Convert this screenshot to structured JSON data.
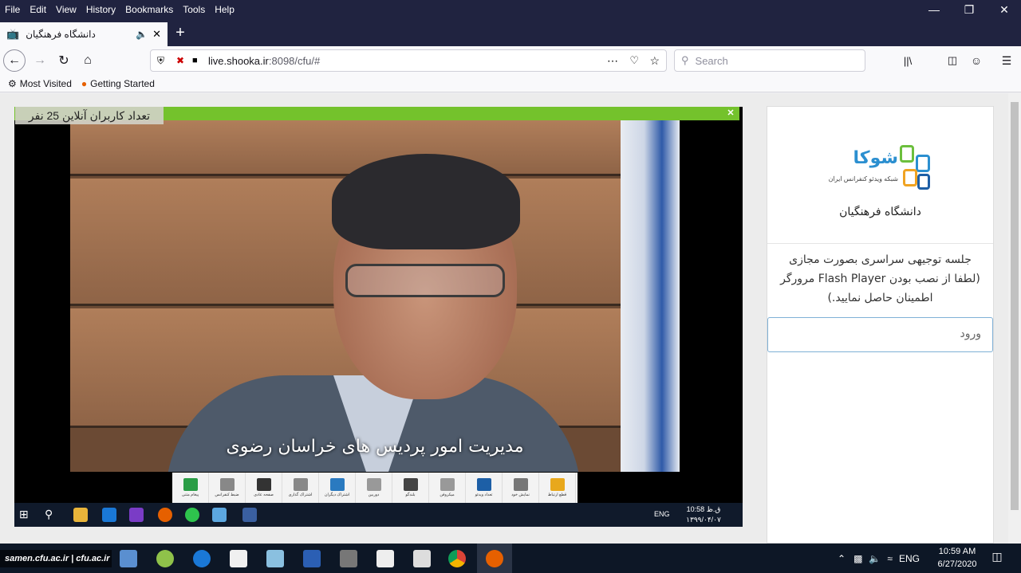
{
  "menubar": {
    "items": [
      "File",
      "Edit",
      "View",
      "History",
      "Bookmarks",
      "Tools",
      "Help"
    ]
  },
  "tab": {
    "title": "دانشگاه فرهنگیان"
  },
  "navbar": {
    "url_host": "live.shooka.ir",
    "url_rest": ":8098/cfu/#",
    "search_placeholder": "Search"
  },
  "bookmarks": [
    "Most Visited",
    "Getting Started"
  ],
  "video": {
    "online_count_label": "تعداد کاربران آنلاین 25 نفر",
    "caption": "مدیریت امور پردیس های خراسان رضوی",
    "toolbar_buttons": [
      "پیغام متنی",
      "ضبط کنفرانس",
      "صفحه عادی",
      "اشتراک گذاری",
      "اشتراک دیگران",
      "دوربین",
      "بلندگو",
      "میکروفن",
      "تعداد ویدئو",
      "نمایش خود",
      "قطع ارتباط"
    ],
    "toolbar_colors": [
      "#2a9d46",
      "#888888",
      "#333333",
      "#888888",
      "#2a7ac0",
      "#999999",
      "#444444",
      "#999999",
      "#1d5fa6",
      "#777777",
      "#e8a81c"
    ],
    "inner_clock_time": "10:58 ق.ظ",
    "inner_clock_date": "۱۳۹۹/۰۴/۰۷",
    "inner_lang": "ENG"
  },
  "right_panel": {
    "logo_title": "شوکا",
    "logo_subtitle": "شبکه ویدئو کنفرانس ایران",
    "university": "دانشگاه فرهنگیان",
    "notice": "جلسه توجیهی سراسری بصورت مجازی (لطفا از نصب بودن Flash Player مرورگر اطمینان حاصل نمایید.)",
    "login_label": "ورود"
  },
  "taskbar": {
    "watermark": "samen.cfu.ac.ir | cfu.ac.ir",
    "lang": "ENG",
    "time": "10:59 AM",
    "date": "6/27/2020"
  }
}
